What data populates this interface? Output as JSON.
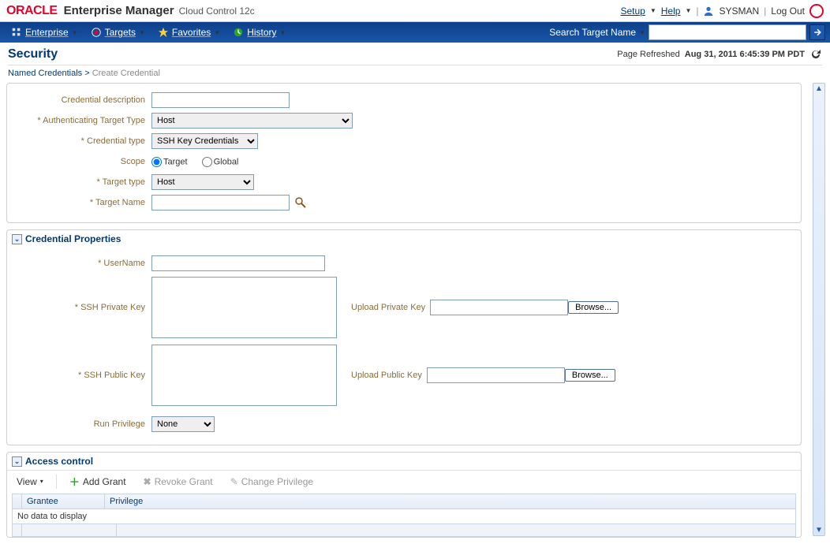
{
  "header": {
    "logo": "ORACLE",
    "product": "Enterprise Manager",
    "product_sub": "Cloud Control 12c",
    "setup": "Setup",
    "help": "Help",
    "user": "SYSMAN",
    "logout": "Log Out"
  },
  "nav": {
    "enterprise": "Enterprise",
    "targets": "Targets",
    "favorites": "Favorites",
    "history": "History",
    "search_label": "Search Target Name"
  },
  "page": {
    "title": "Security",
    "refreshed_label": "Page Refreshed",
    "refreshed_time": "Aug 31, 2011 6:45:39 PM PDT"
  },
  "breadcrumb": {
    "parent": "Named Credentials",
    "current": "Create Credential"
  },
  "form": {
    "desc_label": "Credential description",
    "desc_value": "",
    "auth_type_label": "Authenticating Target Type",
    "auth_type_value": "Host",
    "cred_type_label": "Credential type",
    "cred_type_value": "SSH Key Credentials",
    "scope_label": "Scope",
    "scope_target": "Target",
    "scope_global": "Global",
    "target_type_label": "Target type",
    "target_type_value": "Host",
    "target_name_label": "Target Name",
    "target_name_value": ""
  },
  "cred_props": {
    "title": "Credential Properties",
    "username_label": "UserName",
    "username_value": "",
    "priv_key_label": "SSH Private Key",
    "priv_key_value": "",
    "upload_priv_label": "Upload Private Key",
    "upload_priv_value": "",
    "pub_key_label": "SSH Public Key",
    "pub_key_value": "",
    "upload_pub_label": "Upload Public Key",
    "upload_pub_value": "",
    "browse": "Browse...",
    "run_priv_label": "Run Privilege",
    "run_priv_value": "None"
  },
  "access": {
    "title": "Access control",
    "view": "View",
    "add_grant": "Add Grant",
    "revoke_grant": "Revoke Grant",
    "change_priv": "Change Privilege",
    "col_grantee": "Grantee",
    "col_privilege": "Privilege",
    "empty": "No data to display"
  }
}
